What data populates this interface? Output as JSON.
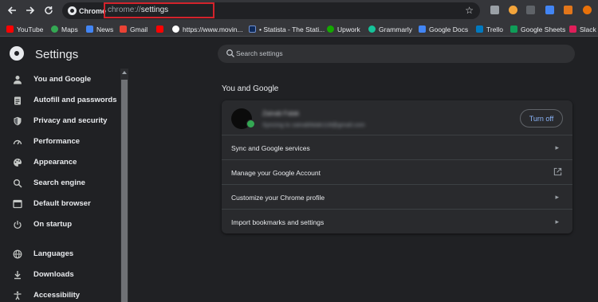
{
  "browser": {
    "tab_chip": "Chrome",
    "url_proto": "chrome://",
    "url_path": "settings"
  },
  "bookmarks": [
    {
      "label": "YouTube",
      "color": "#ff0000"
    },
    {
      "label": "Maps",
      "color": "#34a853"
    },
    {
      "label": "News",
      "color": "#4285f4"
    },
    {
      "label": "Gmail",
      "color": "#ea4335"
    },
    {
      "label": "",
      "color": "#ff0000"
    },
    {
      "label": "https://www.movin...",
      "color": "#ffffff"
    },
    {
      "label": "• Statista - The Stati...",
      "color": "#0f2b5b"
    },
    {
      "label": "Upwork",
      "color": "#14a800"
    },
    {
      "label": "Grammarly",
      "color": "#15c39a"
    },
    {
      "label": "Google Docs",
      "color": "#4285f4"
    },
    {
      "label": "Trello",
      "color": "#0079bf"
    },
    {
      "label": "Google Sheets",
      "color": "#0f9d58"
    },
    {
      "label": "Slack |",
      "color": "#e01e5a"
    }
  ],
  "header": {
    "title": "Settings",
    "search_placeholder": "Search settings"
  },
  "sidebar": {
    "items": [
      {
        "label": "You and Google",
        "icon": "person-icon"
      },
      {
        "label": "Autofill and passwords",
        "icon": "clipboard-icon"
      },
      {
        "label": "Privacy and security",
        "icon": "shield-icon"
      },
      {
        "label": "Performance",
        "icon": "gauge-icon"
      },
      {
        "label": "Appearance",
        "icon": "palette-icon"
      },
      {
        "label": "Search engine",
        "icon": "search-icon"
      },
      {
        "label": "Default browser",
        "icon": "browser-icon"
      },
      {
        "label": "On startup",
        "icon": "power-icon"
      },
      {
        "label": "Languages",
        "icon": "globe-icon"
      },
      {
        "label": "Downloads",
        "icon": "download-icon"
      },
      {
        "label": "Accessibility",
        "icon": "accessibility-icon"
      }
    ]
  },
  "main": {
    "section_title": "You and Google",
    "account": {
      "name": "Zainab Falak",
      "sync_text": "Syncing to zainabfalak118@gmail.com",
      "turn_off_label": "Turn off"
    },
    "rows": [
      {
        "label": "Sync and Google services",
        "icon": "chevron-right-icon"
      },
      {
        "label": "Manage your Google Account",
        "icon": "external-link-icon"
      },
      {
        "label": "Customize your Chrome profile",
        "icon": "chevron-right-icon"
      },
      {
        "label": "Import bookmarks and settings",
        "icon": "chevron-right-icon"
      }
    ]
  }
}
